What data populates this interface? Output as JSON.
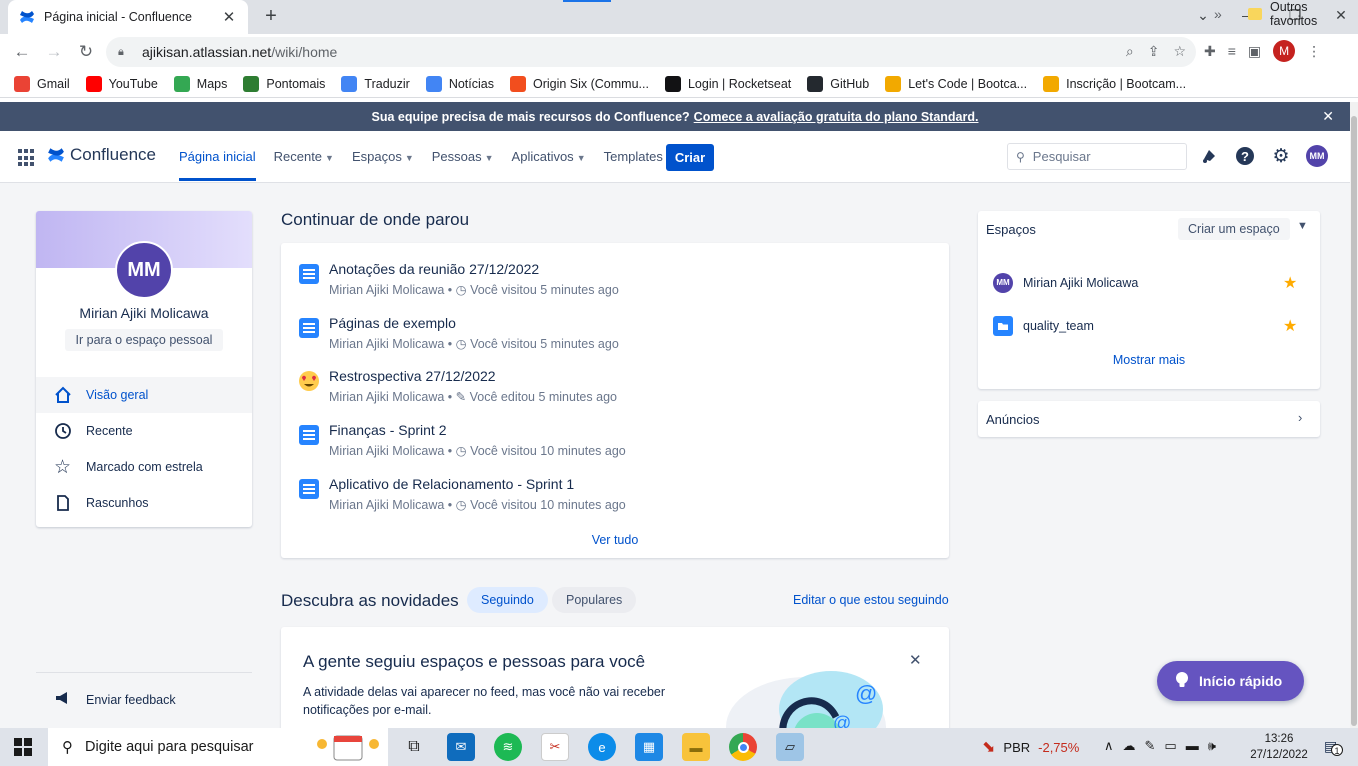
{
  "browser": {
    "tab_title": "Página inicial - Confluence",
    "tab_close": "✕",
    "new_tab": "+",
    "url_host": "ajikisan.atlassian.net",
    "url_path": "/wiki/home",
    "profile_initial": "M",
    "bookmarks": [
      {
        "label": "Gmail",
        "color": "#EA4335"
      },
      {
        "label": "YouTube",
        "color": "#FF0000"
      },
      {
        "label": "Maps",
        "color": "#34A853"
      },
      {
        "label": "Pontomais",
        "color": "#2E7D32"
      },
      {
        "label": "Traduzir",
        "color": "#4285F4"
      },
      {
        "label": "Notícias",
        "color": "#4285F4"
      },
      {
        "label": "Origin Six (Commu...",
        "color": "#F24E1E"
      },
      {
        "label": "Login | Rocketseat",
        "color": "#121214"
      },
      {
        "label": "GitHub",
        "color": "#24292f"
      },
      {
        "label": "Let's Code | Bootca...",
        "color": "#F2A900"
      },
      {
        "label": "Inscrição | Bootcam...",
        "color": "#F2A900"
      }
    ],
    "bookmarks_more": "»",
    "other_bookmarks": "Outros favoritos"
  },
  "banner": {
    "text": "Sua equipe precisa de mais recursos do Confluence?",
    "link": "Comece a avaliação gratuita do plano Standard.",
    "close": "✕"
  },
  "header": {
    "product": "Confluence",
    "nav": [
      {
        "label": "Página inicial",
        "dropdown": false
      },
      {
        "label": "Recente",
        "dropdown": true
      },
      {
        "label": "Espaços",
        "dropdown": true
      },
      {
        "label": "Pessoas",
        "dropdown": true
      },
      {
        "label": "Aplicativos",
        "dropdown": true
      },
      {
        "label": "Templates",
        "dropdown": false
      }
    ],
    "create": "Criar",
    "search_placeholder": "Pesquisar",
    "user_initials": "MM"
  },
  "profile": {
    "initials": "MM",
    "name": "Mirian Ajiki Molicawa",
    "personal_space": "Ir para o espaço pessoal",
    "menu": [
      "Visão geral",
      "Recente",
      "Marcado com estrela",
      "Rascunhos"
    ],
    "feedback": "Enviar feedback"
  },
  "recent": {
    "title": "Continuar de onde parou",
    "items": [
      {
        "title": "Anotações da reunião 27/12/2022",
        "author": "Mirian Ajiki Molicawa",
        "activity": "Você visitou 5 minutes ago",
        "icon": "page-icon"
      },
      {
        "title": "Páginas de exemplo",
        "author": "Mirian Ajiki Molicawa",
        "activity": "Você visitou 5 minutes ago",
        "icon": "page-icon"
      },
      {
        "title": "Restrospectiva 27/12/2022",
        "author": "Mirian Ajiki Molicawa",
        "activity": "Você editou 5 minutes ago",
        "icon": "heart-eyes-emoji-icon"
      },
      {
        "title": "Finanças - Sprint 2",
        "author": "Mirian Ajiki Molicawa",
        "activity": "Você visitou 10 minutes ago",
        "icon": "page-icon"
      },
      {
        "title": "Aplicativo de Relacionamento - Sprint 1",
        "author": "Mirian Ajiki Molicawa",
        "activity": "Você visitou 10 minutes ago",
        "icon": "page-icon"
      }
    ],
    "separator": "•",
    "see_all": "Ver tudo"
  },
  "discover": {
    "title": "Descubra as novidades",
    "tabs": [
      "Seguindo",
      "Populares"
    ],
    "edit_link": "Editar o que estou seguindo",
    "card_title": "A gente seguiu espaços e pessoas para você",
    "card_desc": "A atividade delas vai aparecer no feed, mas você não vai receber notificações por e-mail.",
    "close": "✕"
  },
  "spaces": {
    "title": "Espaços",
    "create": "Criar um espaço",
    "items": [
      {
        "name": "Mirian Ajiki Molicawa",
        "avatar": "MM"
      },
      {
        "name": "quality_team"
      }
    ],
    "show_more": "Mostrar mais"
  },
  "announcements": {
    "title": "Anúncios"
  },
  "quickstart": {
    "label": "Início rápido"
  },
  "taskbar": {
    "search_placeholder": "Digite aqui para pesquisar",
    "stock_label": "PBR",
    "stock_change": "-2,75%",
    "time": "13:26",
    "date": "27/12/2022",
    "notif_count": "1"
  },
  "colors": {
    "confluence_blue": "#0052CC",
    "banner": "#42526E",
    "avatar_purple": "#5243AA",
    "quickstart": "#6554C0",
    "star": "#FFAB00"
  }
}
